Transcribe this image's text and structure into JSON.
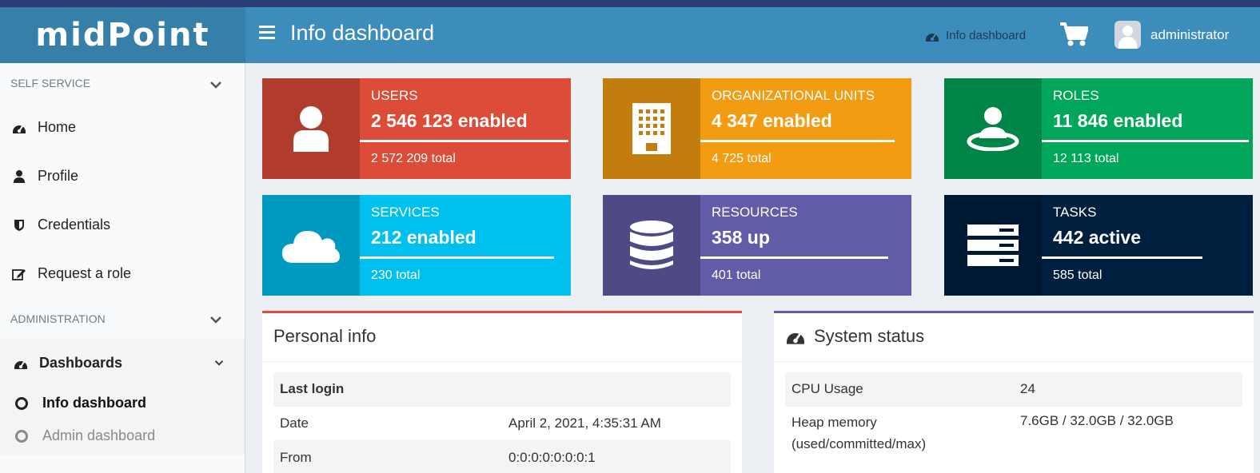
{
  "app": {
    "logo_text": "midPoint",
    "page_title": "Info dashboard",
    "breadcrumb": "Info dashboard",
    "username": "administrator"
  },
  "sidebar": {
    "self_service_label": "SELF SERVICE",
    "self_service_items": [
      {
        "label": "Home",
        "icon": "dashboard-icon"
      },
      {
        "label": "Profile",
        "icon": "user-icon"
      },
      {
        "label": "Credentials",
        "icon": "shield-icon"
      },
      {
        "label": "Request a role",
        "icon": "edit-icon"
      }
    ],
    "administration_label": "ADMINISTRATION",
    "dashboards_label": "Dashboards",
    "dashboard_items": [
      {
        "label": "Info dashboard",
        "active": true
      },
      {
        "label": "Admin dashboard",
        "active": false
      }
    ]
  },
  "tiles": [
    {
      "label": "USERS",
      "value": "2 546 123 enabled",
      "total": "2 572 209 total",
      "icon": "user-icon",
      "color": "#dd4b39",
      "icon_bg": "#b13c2e",
      "fill": 0.99
    },
    {
      "label": "ORGANIZATIONAL UNITS",
      "value": "4 347 enabled",
      "total": "4 725 total",
      "icon": "building-icon",
      "color": "#f39c12",
      "icon_bg": "#c27d0e",
      "fill": 0.92
    },
    {
      "label": "ROLES",
      "value": "11 846 enabled",
      "total": "12 113 total",
      "icon": "role-icon",
      "color": "#00a65a",
      "icon_bg": "#008548",
      "fill": 0.98
    },
    {
      "label": "SERVICES",
      "value": "212 enabled",
      "total": "230 total",
      "icon": "cloud-icon",
      "color": "#00c0ef",
      "icon_bg": "#0099bf",
      "fill": 0.92
    },
    {
      "label": "RESOURCES",
      "value": "358 up",
      "total": "401 total",
      "icon": "database-icon",
      "color": "#605ca8",
      "icon_bg": "#4d4a86",
      "fill": 0.89
    },
    {
      "label": "TASKS",
      "value": "442 active",
      "total": "585 total",
      "icon": "tasks-icon",
      "color": "#001f3f",
      "icon_bg": "#001932",
      "fill": 0.76
    }
  ],
  "personal_info": {
    "title": "Personal info",
    "section": "Last login",
    "rows": [
      {
        "label": "Date",
        "value": "April 2, 2021, 4:35:31 AM"
      },
      {
        "label": "From",
        "value": "0:0:0:0:0:0:0:1"
      }
    ]
  },
  "system_status": {
    "title": "System status",
    "rows": [
      {
        "label": "CPU Usage",
        "value": "24"
      },
      {
        "label": "Heap memory (used/committed/max)",
        "value": "7.6GB / 32.0GB / 32.0GB"
      }
    ]
  }
}
